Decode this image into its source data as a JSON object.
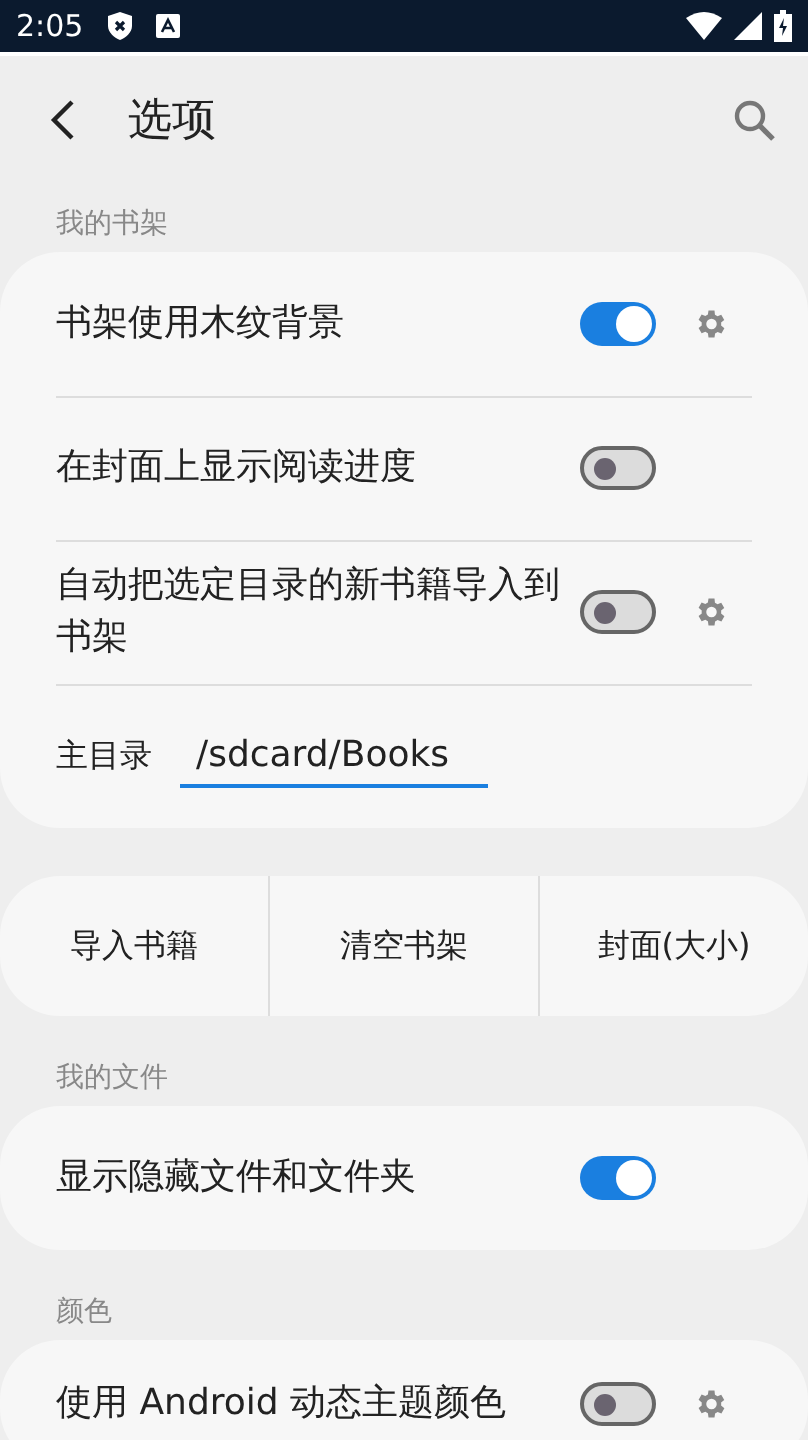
{
  "status_bar": {
    "time": "2:05"
  },
  "header": {
    "title": "选项"
  },
  "groups": [
    {
      "kind": "card",
      "header": "我的书架",
      "rows": [
        {
          "kind": "toggle",
          "label": "书架使用木纹背景",
          "on": true,
          "settings": true
        },
        {
          "kind": "toggle",
          "label": "在封面上显示阅读进度",
          "on": false,
          "settings": false
        },
        {
          "kind": "toggle",
          "label": "自动把选定目录的新书籍导入到书架",
          "on": false,
          "settings": true
        },
        {
          "kind": "field",
          "label": "主目录",
          "value": "/sdcard/Books"
        }
      ]
    },
    {
      "kind": "button_row",
      "buttons": [
        "导入书籍",
        "清空书架",
        "封面(大小)"
      ]
    },
    {
      "kind": "card",
      "header": "我的文件",
      "rows": [
        {
          "kind": "toggle",
          "label": "显示隐藏文件和文件夹",
          "on": true,
          "settings": false
        }
      ]
    },
    {
      "kind": "card",
      "header": "颜色",
      "rows": [
        {
          "kind": "toggle",
          "label": "使用 Android 动态主题颜色",
          "on": false,
          "settings": true
        }
      ]
    }
  ]
}
